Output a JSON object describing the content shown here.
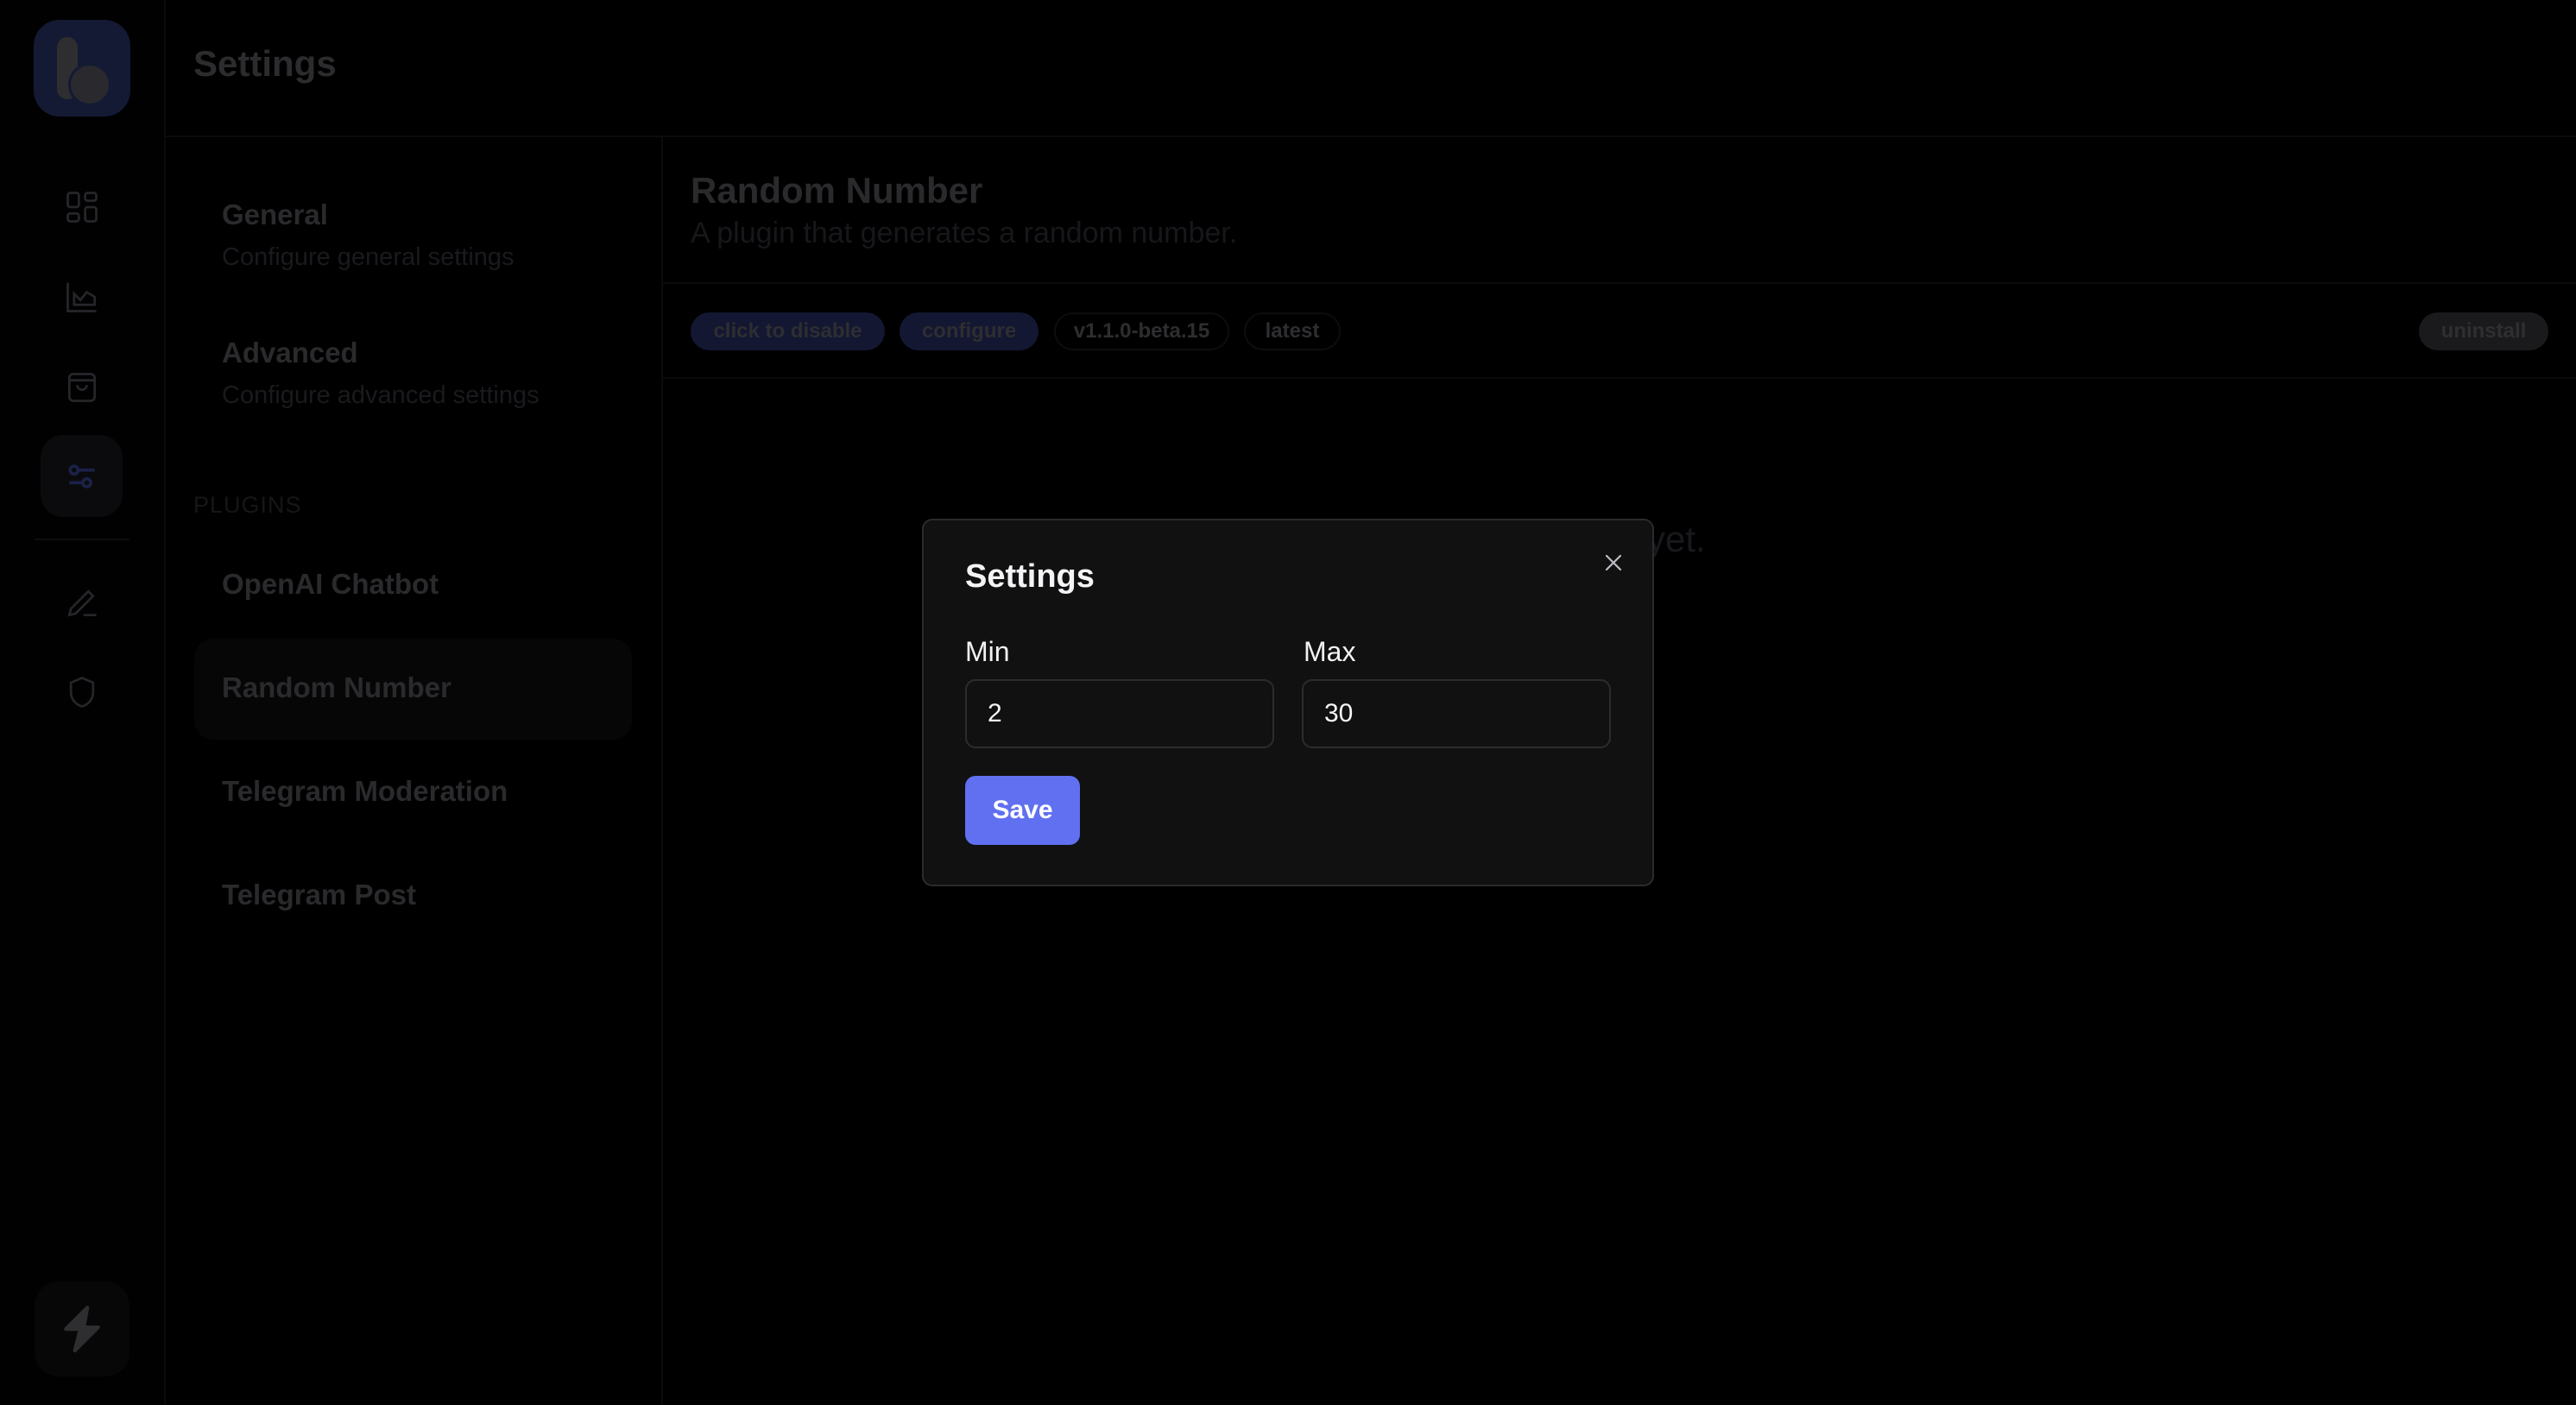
{
  "app": {
    "page_title": "Settings",
    "logo_icon": "b-logo-icon"
  },
  "rail": {
    "items": [
      {
        "name": "dashboard",
        "icon": "grid-icon",
        "active": false
      },
      {
        "name": "analytics",
        "icon": "chart-icon",
        "active": false
      },
      {
        "name": "store",
        "icon": "shopping-bag-icon",
        "active": false
      },
      {
        "name": "settings",
        "icon": "sliders-icon",
        "active": true
      },
      {
        "name": "editor",
        "icon": "pencil-icon",
        "active": false
      },
      {
        "name": "security",
        "icon": "shield-icon",
        "active": false
      }
    ],
    "bottom_icon": "lightning-icon"
  },
  "settings_nav": {
    "items": [
      {
        "title": "General",
        "description": "Configure general settings"
      },
      {
        "title": "Advanced",
        "description": "Configure advanced settings"
      }
    ],
    "plugins_section_label": "PLUGINS",
    "plugins": [
      {
        "label": "OpenAI Chatbot",
        "active": false
      },
      {
        "label": "Random Number",
        "active": true
      },
      {
        "label": "Telegram Moderation",
        "active": false
      },
      {
        "label": "Telegram Post",
        "active": false
      }
    ]
  },
  "plugin": {
    "title": "Random Number",
    "description": "A plugin that generates a random number.",
    "tags": {
      "toggle": "click to disable",
      "configure": "configure",
      "version": "v1.1.0-beta.15",
      "channel": "latest",
      "uninstall": "uninstall"
    },
    "empty_message_visible": "yet."
  },
  "modal": {
    "title": "Settings",
    "close_icon": "close-icon",
    "fields": {
      "min": {
        "label": "Min",
        "value": "2"
      },
      "max": {
        "label": "Max",
        "value": "30"
      }
    },
    "save_label": "Save"
  },
  "colors": {
    "accent": "#6070f0",
    "tag_blue": "#131732",
    "modal_bg": "#111112",
    "logo_bg": "#141a33"
  }
}
